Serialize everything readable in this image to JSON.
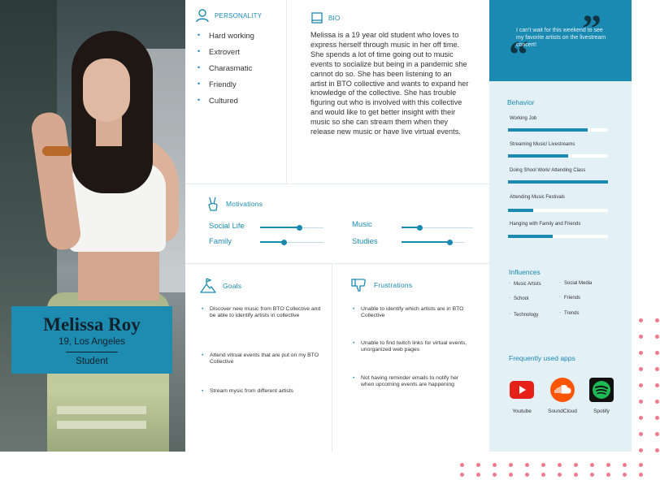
{
  "persona": {
    "name": "Melissa Roy",
    "subtitle": "19, Los Angeles",
    "role": "Student"
  },
  "personality": {
    "title": "PERSONALITY",
    "traits": [
      "Hard working",
      "Extrovert",
      "Charasmatic",
      "Friendly",
      "Cultured"
    ]
  },
  "bio": {
    "title": "BIO",
    "text": "Melissa is a 19 year old student who loves to express herself through music in her off time. She spends a lot of time going out to music events to socialize but being in a pandemic she cannot do so. She has been listening to an artist in BTO collective and wants to expand her knowledge of the collective. She has trouble figuring out who is involved with this collective and would like to get better insight with their music so she can stream them when they release new music or have live virtual events."
  },
  "motivations": {
    "title": "Motivations",
    "items": [
      {
        "label": "Social Life",
        "level": 0.62
      },
      {
        "label": "Music",
        "level": 0.25
      },
      {
        "label": "Family",
        "level": 0.37
      },
      {
        "label": "Studies",
        "level": 0.75
      }
    ]
  },
  "goals": {
    "title": "Goals",
    "items": [
      "Discover new music from BTO Collective and be able to identify artists in collective",
      "Attend vitrual events that are put on my BTO Collective",
      "Stream mysic from different artists"
    ]
  },
  "frustrations": {
    "title": "Frustrations",
    "items": [
      "Unable to identify which artists are in BTO Collective",
      "Unable to find twitch links for virtual events, unorganized web pages",
      "Not having reminder emails to notify her when upcoming events are happening"
    ]
  },
  "quote": "I can't wait for this weekend to see my favorite artists on the livestream concert!",
  "behavior": {
    "title": "Behavior",
    "items": [
      {
        "label": "Working Job",
        "level": 0.8
      },
      {
        "label": "Streaming Music/ Livestreams",
        "level": 0.6
      },
      {
        "label": "Doing Shool Work/ Attending Class",
        "level": 1.0
      },
      {
        "label": "Attending Music Festivals",
        "level": 0.25
      },
      {
        "label": "Hanging with Family and Friends",
        "level": 0.45
      }
    ]
  },
  "influences": {
    "title": "Influences",
    "items": [
      "Music Artists",
      "Social Media",
      "School",
      "Friends",
      "Technology",
      "Trends"
    ]
  },
  "apps": {
    "title": "Frequently used apps",
    "items": [
      {
        "label": "Youtube",
        "icon": "youtube-icon",
        "color": "#e62117"
      },
      {
        "label": "SoundCloud",
        "icon": "soundcloud-icon",
        "color": "#ff5500"
      },
      {
        "label": "Spotify",
        "icon": "spotify-icon",
        "color": "#1db954"
      }
    ]
  },
  "colors": {
    "accent": "#1b8ab2",
    "side_panel": "#e3f0f6",
    "dots": "#f07b8f"
  }
}
